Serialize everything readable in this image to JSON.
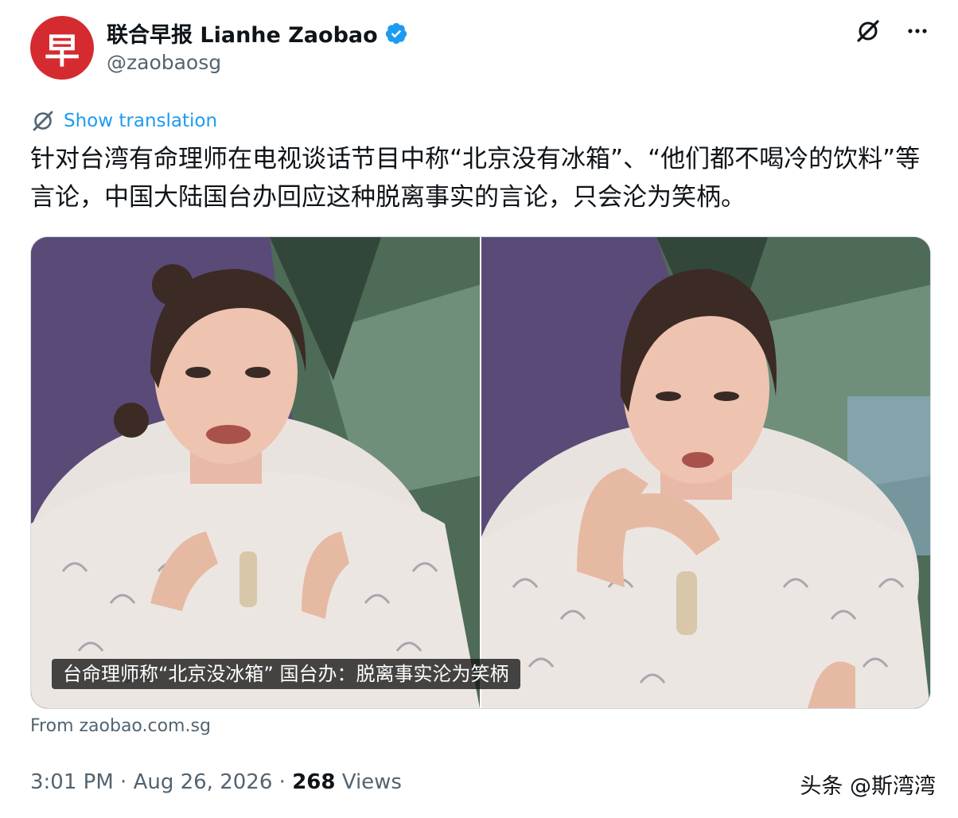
{
  "account": {
    "avatar_char": "早",
    "display_name": "联合早报 Lianhe Zaobao",
    "handle": "@zaobaosg"
  },
  "actions": {
    "translate_label": "Show translation"
  },
  "tweet": {
    "text": "针对台湾有命理师在电视谈话节目中称“北京没有冰箱”、“他们都不喝冷的饮料”等言论，中国大陆国台办回应这种脱离事实的言论，只会沦为笑柄。"
  },
  "media": {
    "caption": "台命理师称“北京没冰箱” 国台办：脱离事实沦为笑柄"
  },
  "card": {
    "source": "From zaobao.com.sg"
  },
  "meta": {
    "time": "3:01 PM",
    "separator": "·",
    "date": "Aug 26, 2026",
    "views_count": "268",
    "views_label": "Views"
  },
  "watermark": "头条 @斯湾湾",
  "colors": {
    "brand_red": "#d52b30",
    "link_blue": "#1d9bf0",
    "verified_blue": "#1d9bf0",
    "secondary_text": "#536471"
  },
  "icons": [
    "verified-badge-icon",
    "grok-icon",
    "more-icon",
    "translate-icon"
  ]
}
